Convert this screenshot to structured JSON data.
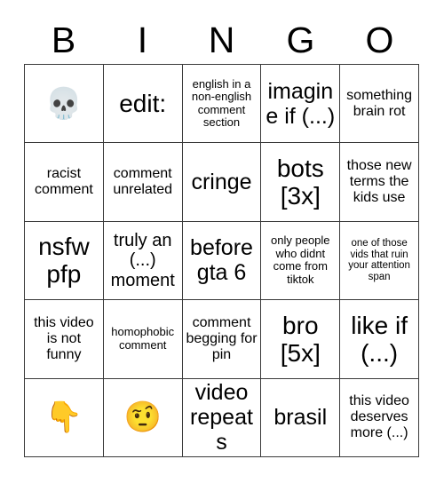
{
  "header": {
    "letters": [
      "B",
      "I",
      "N",
      "G",
      "O"
    ]
  },
  "grid": {
    "rows": 5,
    "columns": 5,
    "cells": [
      {
        "text": "💀",
        "kind": "emoji",
        "icon": "skull-emoji",
        "size": "sz-emoji"
      },
      {
        "text": "edit:",
        "kind": "text",
        "size": "sz-xl"
      },
      {
        "text": "english in a non-english comment section",
        "kind": "text",
        "size": "sz-xs"
      },
      {
        "text": "imagine if (...)",
        "kind": "text",
        "size": "sz-lg"
      },
      {
        "text": "something brain rot",
        "kind": "text",
        "size": "sz-sm"
      },
      {
        "text": "racist comment",
        "kind": "text",
        "size": "sz-sm"
      },
      {
        "text": "comment unrelated",
        "kind": "text",
        "size": "sz-sm"
      },
      {
        "text": "cringe",
        "kind": "text",
        "size": "sz-lg"
      },
      {
        "text": "bots [3x]",
        "kind": "text",
        "size": "sz-xl"
      },
      {
        "text": "those new terms the kids use",
        "kind": "text",
        "size": "sz-sm"
      },
      {
        "text": "nsfw pfp",
        "kind": "text",
        "size": "sz-xl"
      },
      {
        "text": "truly an (...) moment",
        "kind": "text",
        "size": "sz-md"
      },
      {
        "text": "before gta 6",
        "kind": "text",
        "size": "sz-lg"
      },
      {
        "text": "only people who didnt come from tiktok",
        "kind": "text",
        "size": "sz-xs"
      },
      {
        "text": "one of those vids that ruin your attention span",
        "kind": "text",
        "size": "sz-xxs"
      },
      {
        "text": "this video is not funny",
        "kind": "text",
        "size": "sz-sm"
      },
      {
        "text": "homophobic comment",
        "kind": "text",
        "size": "sz-xs"
      },
      {
        "text": "comment begging for pin",
        "kind": "text",
        "size": "sz-sm"
      },
      {
        "text": "bro [5x]",
        "kind": "text",
        "size": "sz-xl"
      },
      {
        "text": "like if (...)",
        "kind": "text",
        "size": "sz-xl"
      },
      {
        "text": "👇",
        "kind": "emoji",
        "icon": "pointing-down-emoji",
        "size": "sz-emoji"
      },
      {
        "text": "🤨",
        "kind": "emoji",
        "icon": "raised-eyebrow-emoji",
        "size": "sz-emoji"
      },
      {
        "text": "video repeats",
        "kind": "text",
        "size": "sz-lg"
      },
      {
        "text": "brasil",
        "kind": "text",
        "size": "sz-lg"
      },
      {
        "text": "this video deserves more (...)",
        "kind": "text",
        "size": "sz-sm"
      }
    ]
  },
  "colors": {
    "background": "#ffffff",
    "border": "#3a3a3a",
    "text": "#000000"
  }
}
